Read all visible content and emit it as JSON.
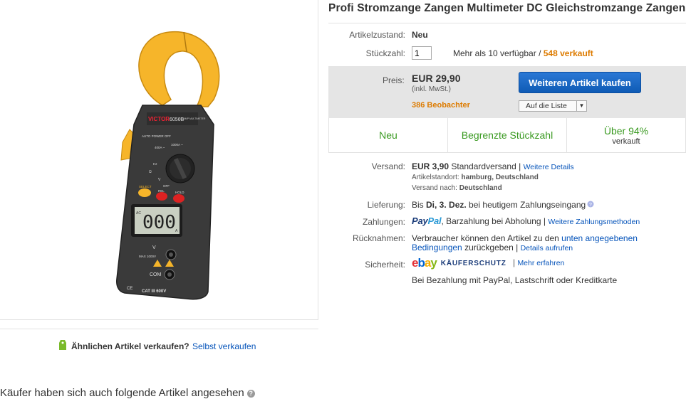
{
  "product": {
    "title": "Profi Stromzange Zangen Multimeter DC Gleichstromzange Zangen"
  },
  "image": {
    "brand": "VICTOR",
    "model": "6056B",
    "model_caption": "CLAMP MULTIMETER",
    "display": "000",
    "labels": {
      "auto_power_off": "AUTO POWER OFF",
      "r1000": "1000A ~",
      "r400a": "400A ~",
      "hz": "Hz",
      "ohm": "Ω",
      "off": "OFF",
      "v": "V",
      "select": "SELECT",
      "rel": "REL",
      "hold": "HOLD",
      "ac": "AC",
      "unit_a": "A",
      "vterm": "V",
      "max": "MAX 1000V",
      "com": "COM",
      "cat": "CAT III 600V",
      "ce": "CE"
    }
  },
  "sell_similar": {
    "question": "Ähnlichen Artikel verkaufen?",
    "link": "Selbst verkaufen"
  },
  "also_viewed": {
    "heading": "Käufer haben sich auch folgende Artikel angesehen",
    "help": "?"
  },
  "details": {
    "condition_label": "Artikelzustand:",
    "condition_value": "Neu",
    "qty_label": "Stückzahl:",
    "qty_value": "1",
    "available": "Mehr als 10 verfügbar",
    "sep": " / ",
    "sold": "548 verkauft",
    "price_label": "Preis:",
    "price": "EUR 29,90",
    "vat": "(inkl. MwSt.)",
    "watchers": "386 Beobachter",
    "buy_button": "Weiteren Artikel kaufen",
    "list_button": "Auf die Liste",
    "list_caret": "▼",
    "badges": [
      {
        "main": "Neu",
        "sub": ""
      },
      {
        "main": "Begrenzte Stückzahl",
        "sub": ""
      },
      {
        "main": "Über 94%",
        "sub": "verkauft"
      }
    ],
    "shipping_label": "Versand:",
    "shipping_price": "EUR 3,90",
    "shipping_method": "Standardversand |",
    "shipping_more": "Weitere Details",
    "location_label": "Artikelstandort:",
    "location_value": "hamburg, Deutschland",
    "ship_to_label": "Versand nach:",
    "ship_to_value": "Deutschland",
    "delivery_label": "Lieferung:",
    "delivery_pre": "Bis",
    "delivery_date": "Di, 3. Dez.",
    "delivery_post": "bei heutigem Zahlungseingang",
    "payment_label": "Zahlungen:",
    "paypal_1": "Pay",
    "paypal_2": "Pal",
    "payment_text": ", Barzahlung bei Abholung |",
    "payment_more": "Weitere Zahlungsmethoden",
    "returns_label": "Rücknahmen:",
    "returns_text_1": "Verbraucher können den Artikel zu den",
    "returns_link_1": "unten angegebenen",
    "returns_link_2": "Bedingungen",
    "returns_text_2": "zurückgeben |",
    "returns_more": "Details aufrufen",
    "security_label": "Sicherheit:",
    "ebay_e": "e",
    "ebay_b": "b",
    "ebay_a": "a",
    "ebay_y": "y",
    "kaeuferschutz": "KÄUFERSCHUTZ",
    "security_more": "Mehr erfahren",
    "security_text": "Bei Bezahlung mit PayPal, Lastschrift oder Kreditkarte"
  },
  "colors": {
    "link": "#0654ba",
    "accent_orange": "#dd7b00",
    "badge_green": "#3a9a21",
    "button_blue": "#1666c5"
  }
}
